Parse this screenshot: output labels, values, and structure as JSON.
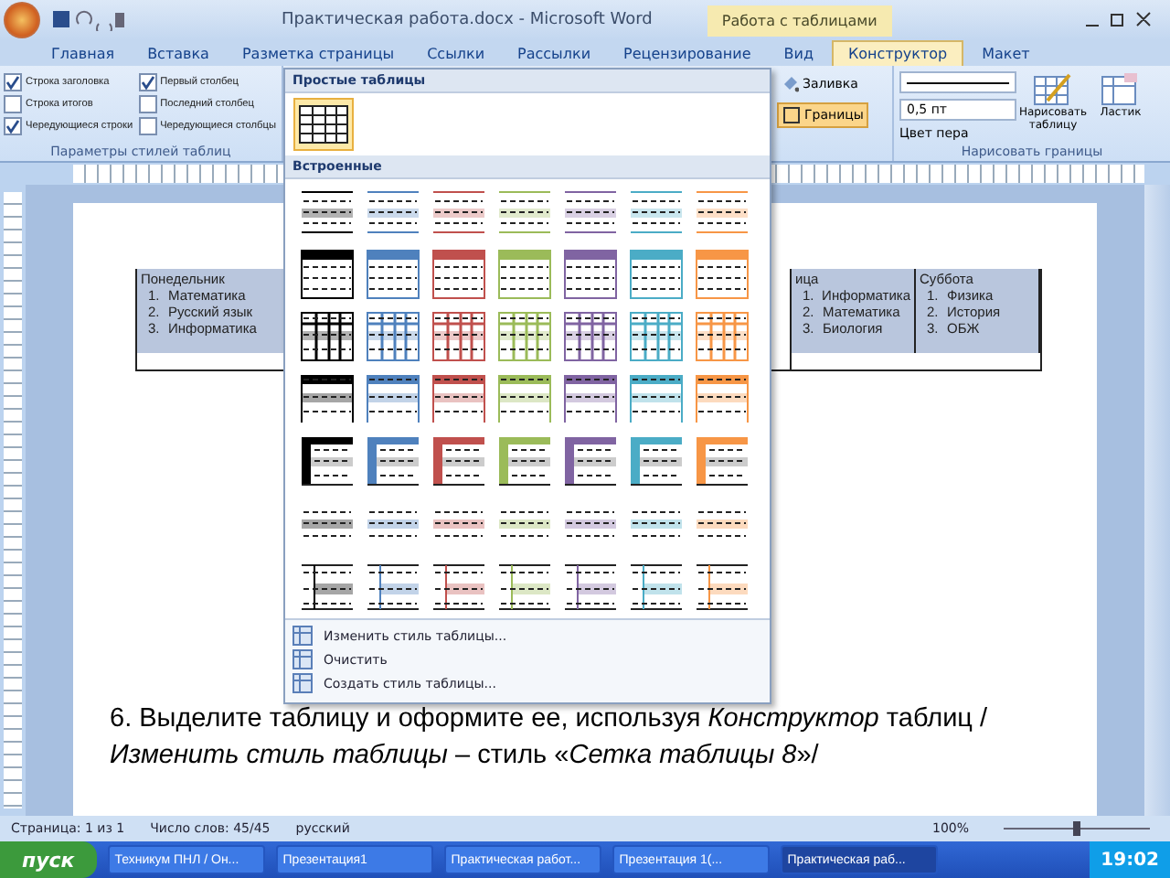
{
  "window": {
    "title": "Практическая работа.docx - Microsoft Word",
    "context_tab": "Работа с таблицами"
  },
  "tabs": [
    {
      "label": "Главная",
      "selected": false
    },
    {
      "label": "Вставка",
      "selected": false
    },
    {
      "label": "Разметка страницы",
      "selected": false
    },
    {
      "label": "Ссылки",
      "selected": false
    },
    {
      "label": "Рассылки",
      "selected": false
    },
    {
      "label": "Рецензирование",
      "selected": false
    },
    {
      "label": "Вид",
      "selected": false
    },
    {
      "label": "Конструктор",
      "selected": true
    },
    {
      "label": "Макет",
      "selected": false
    }
  ],
  "style_options": {
    "items": [
      {
        "label": "Строка заголовка",
        "checked": true
      },
      {
        "label": "Строка итогов",
        "checked": false
      },
      {
        "label": "Чередующиеся строки",
        "checked": true
      },
      {
        "label": "Первый столбец",
        "checked": true
      },
      {
        "label": "Последний столбец",
        "checked": false
      },
      {
        "label": "Чередующиеся столбцы",
        "checked": false
      }
    ],
    "group": "Параметры стилей таблиц"
  },
  "shading": {
    "label": "Заливка"
  },
  "borders": {
    "label": "Границы"
  },
  "draw_borders": {
    "pen_weight": "0,5 пт",
    "pen_color": "Цвет пера",
    "draw_table": "Нарисовать таблицу",
    "eraser": "Ластик",
    "group": "Нарисовать границы"
  },
  "gallery": {
    "simple_title": "Простые таблицы",
    "simple_styles": [
      {
        "selected": true
      }
    ],
    "builtin_title": "Встроенные",
    "palette": [
      {
        "color": "#000000"
      },
      {
        "color": "#4f81bd"
      },
      {
        "color": "#c0504d"
      },
      {
        "color": "#9bbb59"
      },
      {
        "color": "#8064a2"
      },
      {
        "color": "#4bacc6"
      },
      {
        "color": "#f79646"
      }
    ],
    "rows": [
      {
        "kind": "light-shading"
      },
      {
        "kind": "light-list"
      },
      {
        "kind": "light-grid"
      },
      {
        "kind": "medium-shading"
      },
      {
        "kind": "first-column"
      },
      {
        "kind": "light-bands"
      },
      {
        "kind": "outline"
      }
    ],
    "menu": [
      {
        "label": "Изменить стиль таблицы..."
      },
      {
        "label": "Очистить"
      },
      {
        "label": "Создать стиль таблицы..."
      }
    ]
  },
  "table": {
    "columns": [
      {
        "heading": "Понедельник",
        "items": [
          {
            "num": "1.",
            "text": "Математика"
          },
          {
            "num": "2.",
            "text": "Русский язык"
          },
          {
            "num": "3.",
            "text": "Информатика"
          }
        ]
      },
      {
        "heading": "ица",
        "items": [
          {
            "num": "1.",
            "text": "Информатика"
          },
          {
            "num": "2.",
            "text": "Математика"
          },
          {
            "num": "3.",
            "text": "Биология"
          }
        ]
      },
      {
        "heading": "Суббота",
        "items": [
          {
            "num": "1.",
            "text": "Физика"
          },
          {
            "num": "2.",
            "text": "История"
          },
          {
            "num": "3.",
            "text": "ОБЖ"
          }
        ]
      }
    ]
  },
  "instruction": "6. Выделите таблицу и оформите ее, используя *Конструктор* таблиц /*Изменить стиль таблицы* – стиль «*Сетка таблицы 8*»/",
  "status_bar": {
    "page": "Страница: 1 из 1",
    "words": "Число слов: 45/45",
    "language": "русский",
    "zoom": "100%",
    "zoom_slider": {
      "level": 0.5
    }
  },
  "taskbar": {
    "start": "пуск",
    "items": [
      {
        "label": "Техникум ПНЛ / Он...",
        "selected": false
      },
      {
        "label": "Презентация1",
        "selected": false
      },
      {
        "label": "Практическая работ...",
        "selected": false
      },
      {
        "label": "Презентация 1(...",
        "selected": false
      },
      {
        "label": "Практическая раб...",
        "selected": true
      }
    ],
    "clock": "19:02"
  }
}
